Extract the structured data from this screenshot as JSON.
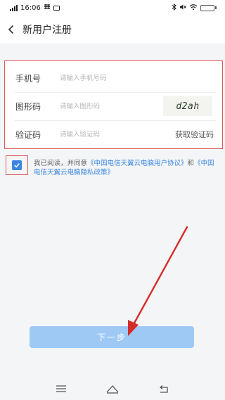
{
  "status_bar": {
    "time": "16:06",
    "battery_fill_percent": 80,
    "battery_color": "#f2c94c"
  },
  "header": {
    "title": "新用户注册",
    "back_icon": "chevron-left-icon"
  },
  "form": {
    "phone": {
      "label": "手机号",
      "placeholder": "请输入手机号码",
      "value": ""
    },
    "captcha": {
      "label": "图形码",
      "placeholder": "请输入图形码",
      "value": "",
      "image_text": "d2ah"
    },
    "sms_code": {
      "label": "验证码",
      "placeholder": "请输入验证码",
      "value": "",
      "button_label": "获取验证码"
    }
  },
  "agreement": {
    "checked": true,
    "prefix": "我已阅读，并同意",
    "link1": "《中国电信天翼云电脑用户协议》",
    "conjunction": "和",
    "link2": "《中国电信天翼云电脑隐私政策》"
  },
  "next_button": {
    "label": "下一步",
    "color": "#9ec9f5"
  },
  "colors": {
    "accent": "#3a86e0",
    "highlight_box": "#e05a5a",
    "annotation_arrow": "#d62b2b"
  },
  "system_nav": {
    "icons": [
      "menu-icon",
      "home-icon",
      "back-icon"
    ]
  }
}
